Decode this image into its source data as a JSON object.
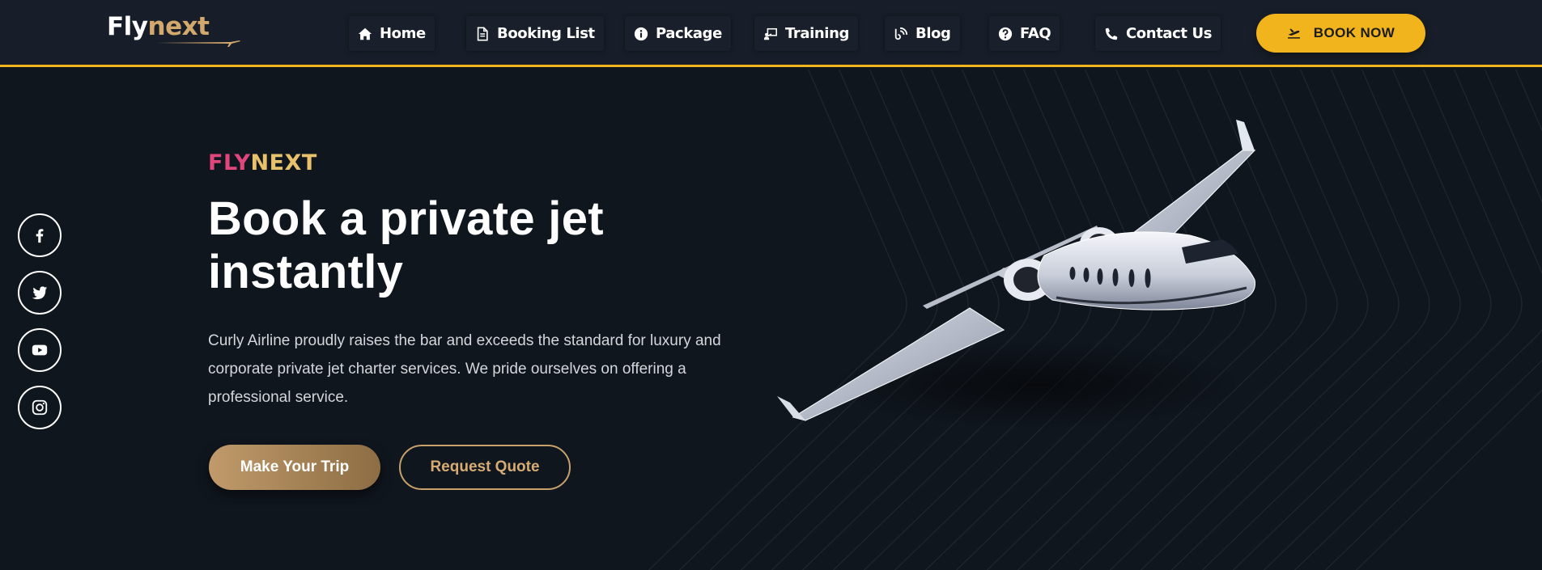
{
  "brand": {
    "logo_part1": "Fly",
    "logo_part2": "next",
    "accent_color": "#f2b41c",
    "gold_color": "#d3a86d"
  },
  "nav": {
    "items": [
      {
        "label": "Home",
        "icon": "home-icon"
      },
      {
        "label": "Booking List",
        "icon": "document-icon"
      },
      {
        "label": "Package",
        "icon": "info-circle-icon"
      },
      {
        "label": "Training",
        "icon": "chalkboard-teacher-icon"
      },
      {
        "label": "Blog",
        "icon": "blog-icon"
      },
      {
        "label": "FAQ",
        "icon": "question-circle-icon"
      },
      {
        "label": "Contact Us",
        "icon": "phone-icon"
      }
    ],
    "cta_label": "BOOK NOW",
    "cta_icon": "plane-departure-icon"
  },
  "social": [
    {
      "name": "Facebook",
      "icon": "facebook-icon"
    },
    {
      "name": "Twitter",
      "icon": "twitter-icon"
    },
    {
      "name": "YouTube",
      "icon": "youtube-icon"
    },
    {
      "name": "Instagram",
      "icon": "instagram-icon"
    }
  ],
  "hero": {
    "eyebrow_part1": "FLY",
    "eyebrow_part2": "NEXT",
    "eyebrow_colors": [
      "#e0457b",
      "#e9c16b"
    ],
    "headline_line1": "Book a private jet",
    "headline_line2": "instantly",
    "description": "Curly Airline proudly raises the bar and exceeds the standard for luxury and corporate private jet charter services. We pride ourselves on offering a professional service.",
    "primary_button": "Make Your Trip",
    "secondary_button": "Request Quote"
  }
}
